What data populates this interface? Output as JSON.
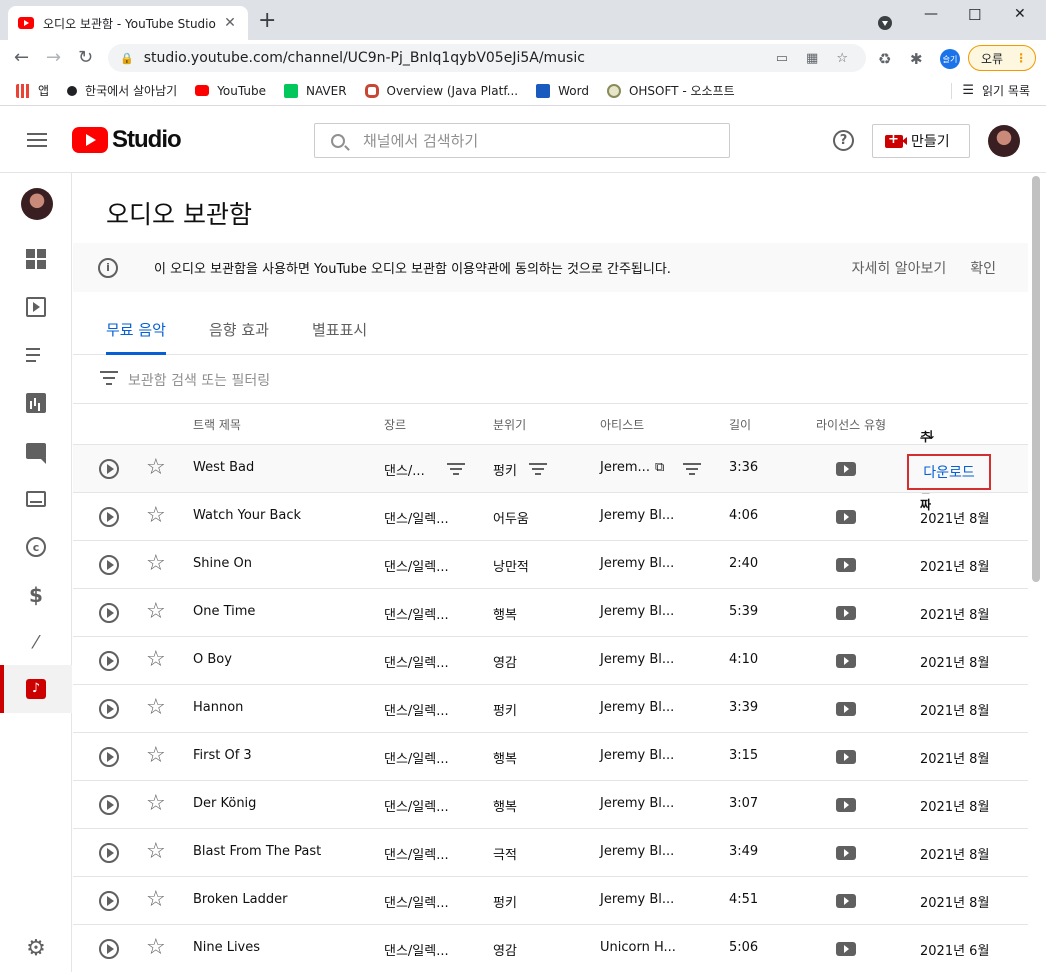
{
  "browser": {
    "tab_title": "오디오 보관함 - YouTube Studio",
    "url": "studio.youtube.com/channel/UC9n-Pj_BnIq1qybV05eJi5A/music",
    "profile_badge": "슬기",
    "error_label": "오류",
    "bookmarks": [
      "앱",
      "한국에서 살아남기",
      "YouTube",
      "NAVER",
      "Overview (Java Platf...",
      "Word",
      "OHSOFT - 오소프트"
    ],
    "reading_list": "읽기 목록"
  },
  "header": {
    "logo_text": "Studio",
    "search_placeholder": "채널에서 검색하기",
    "help": "?",
    "create_label": "만들기"
  },
  "page": {
    "title": "오디오 보관함",
    "banner": "이 오디오 보관함을 사용하면 YouTube 오디오 보관함 이용약관에 동의하는 것으로 간주됩니다.",
    "learn_more": "자세히 알아보기",
    "confirm": "확인",
    "tabs": [
      "무료 음악",
      "음향 효과",
      "별표표시"
    ],
    "filter_placeholder": "보관함 검색 또는 필터링"
  },
  "table": {
    "headers": {
      "title": "트랙 제목",
      "genre": "장르",
      "mood": "분위기",
      "artist": "아티스트",
      "duration": "길이",
      "license": "라이선스 유형",
      "added": "추가된 날짜"
    },
    "download_label": "다운로드",
    "rows": [
      {
        "title": "West Bad",
        "genre": "댄스/...",
        "mood": "펑키",
        "artist": "Jerem...",
        "duration": "3:36",
        "added": ""
      },
      {
        "title": "Watch Your Back",
        "genre": "댄스/일렉...",
        "mood": "어두움",
        "artist": "Jeremy Bl...",
        "duration": "4:06",
        "added": "2021년 8월"
      },
      {
        "title": "Shine On",
        "genre": "댄스/일렉...",
        "mood": "낭만적",
        "artist": "Jeremy Bl...",
        "duration": "2:40",
        "added": "2021년 8월"
      },
      {
        "title": "One Time",
        "genre": "댄스/일렉...",
        "mood": "행복",
        "artist": "Jeremy Bl...",
        "duration": "5:39",
        "added": "2021년 8월"
      },
      {
        "title": "O Boy",
        "genre": "댄스/일렉...",
        "mood": "영감",
        "artist": "Jeremy Bl...",
        "duration": "4:10",
        "added": "2021년 8월"
      },
      {
        "title": "Hannon",
        "genre": "댄스/일렉...",
        "mood": "펑키",
        "artist": "Jeremy Bl...",
        "duration": "3:39",
        "added": "2021년 8월"
      },
      {
        "title": "First Of 3",
        "genre": "댄스/일렉...",
        "mood": "행복",
        "artist": "Jeremy Bl...",
        "duration": "3:15",
        "added": "2021년 8월"
      },
      {
        "title": "Der König",
        "genre": "댄스/일렉...",
        "mood": "행복",
        "artist": "Jeremy Bl...",
        "duration": "3:07",
        "added": "2021년 8월"
      },
      {
        "title": "Blast From The Past",
        "genre": "댄스/일렉...",
        "mood": "극적",
        "artist": "Jeremy Bl...",
        "duration": "3:49",
        "added": "2021년 8월"
      },
      {
        "title": "Broken Ladder",
        "genre": "댄스/일렉...",
        "mood": "펑키",
        "artist": "Jeremy Bl...",
        "duration": "4:51",
        "added": "2021년 8월"
      },
      {
        "title": "Nine Lives",
        "genre": "댄스/일렉...",
        "mood": "영감",
        "artist": "Unicorn H...",
        "duration": "5:06",
        "added": "2021년 6월"
      }
    ]
  },
  "colors": {
    "brand_red": "#ff0000",
    "link_blue": "#065fd4",
    "highlight_box": "#d32f2f"
  }
}
